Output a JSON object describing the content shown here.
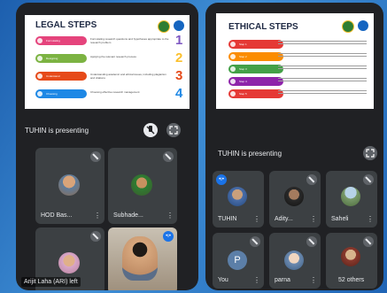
{
  "left": {
    "slide": {
      "title": "LEGAL STEPS",
      "steps": [
        {
          "label": "Formulating",
          "desc": "Formulating research questions and hypotheses appropriate to the research problem",
          "number": "1",
          "color": "#e5447c"
        },
        {
          "label": "Designing",
          "desc": "Applying the relevant research process",
          "number": "2",
          "color": "#7cb342"
        },
        {
          "label": "Understand",
          "desc": "Understanding academic and ethical issues, including plagiarism and citations",
          "number": "3",
          "color": "#e64a19"
        },
        {
          "label": "Choosing",
          "desc": "Choosing effective research management",
          "number": "4",
          "color": "#1e88e5"
        }
      ],
      "number_colors": [
        "#7e57c2",
        "#fbc02d",
        "#e64a19",
        "#1e88e5"
      ]
    },
    "presenting_text": "TUHIN is presenting",
    "participants": [
      {
        "name": "HOD Bas...",
        "more": "⋮"
      },
      {
        "name": "Subhade...",
        "more": "⋮"
      }
    ],
    "toast": "Arijit Laha (ARI) left"
  },
  "right": {
    "slide": {
      "title": "ETHICAL STEPS",
      "steps": [
        {
          "label": "Step 1",
          "desc": "",
          "color": "#e53935"
        },
        {
          "label": "Step 2",
          "desc": "",
          "color": "#fb8c00"
        },
        {
          "label": "Step 3",
          "desc": "",
          "color": "#43a047"
        },
        {
          "label": "Step 4",
          "desc": "",
          "color": "#8e24aa"
        },
        {
          "label": "Step 5",
          "desc": "",
          "color": "#e53935"
        }
      ]
    },
    "presenting_text": "TUHIN is presenting",
    "participants": [
      {
        "name": "TUHIN",
        "more": "⋮"
      },
      {
        "name": "Adity...",
        "more": "⋮"
      },
      {
        "name": "Saheli",
        "more": "⋮"
      },
      {
        "name": "You",
        "more": "⋮",
        "initial": "P"
      },
      {
        "name": "parna",
        "more": "⋮"
      }
    ],
    "others_badge": "52 others"
  }
}
